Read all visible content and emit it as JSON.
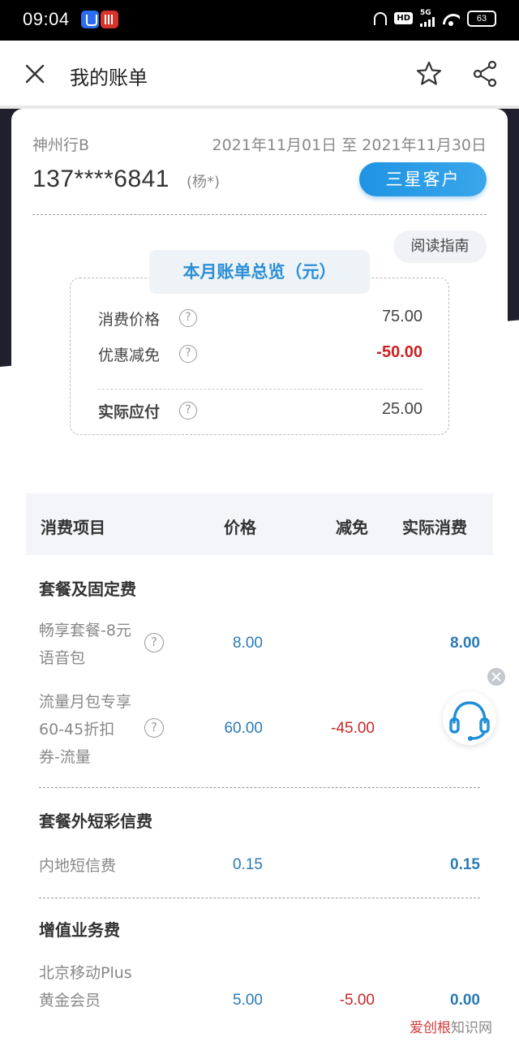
{
  "status_bar": {
    "time": "09:04",
    "hd": "HD",
    "network": "5G",
    "battery": "63"
  },
  "header": {
    "title": "我的账单"
  },
  "account": {
    "carrier": "神州行B",
    "date_range": "2021年11月01日 至 2021年11月30日",
    "phone": "137****6841",
    "owner": "(杨*)",
    "tier": "三星客户"
  },
  "guide_label": "阅读指南",
  "summary": {
    "title": "本月账单总览（元）",
    "rows": [
      {
        "label": "消费价格",
        "value": "75.00"
      },
      {
        "label": "优惠减免",
        "value": "-50.00"
      },
      {
        "label": "实际应付",
        "value": "25.00"
      }
    ]
  },
  "table": {
    "headers": [
      "消费项目",
      "价格",
      "减免",
      "实际消费"
    ],
    "sections": [
      {
        "title": "套餐及固定费",
        "items": [
          {
            "name": "畅享套餐-8元语音包",
            "price": "8.00",
            "discount": "",
            "actual": "8.00"
          },
          {
            "name": "流量月包专享60-45折扣券-流量",
            "price": "60.00",
            "discount": "-45.00",
            "actual": ""
          }
        ]
      },
      {
        "title": "套餐外短彩信费",
        "items": [
          {
            "name": "内地短信费",
            "price": "0.15",
            "discount": "",
            "actual": "0.15"
          }
        ]
      },
      {
        "title": "增值业务费",
        "items": [
          {
            "name": "北京移动Plus黄金会员",
            "price": "5.00",
            "discount": "-5.00",
            "actual": "0.00"
          }
        ]
      }
    ]
  },
  "watermark": {
    "brand": "爱创根",
    "suffix": "知识网"
  },
  "colors": {
    "accent": "#2b8fd6",
    "negative": "#cc1f1f",
    "value_blue": "#2a7bb5"
  }
}
